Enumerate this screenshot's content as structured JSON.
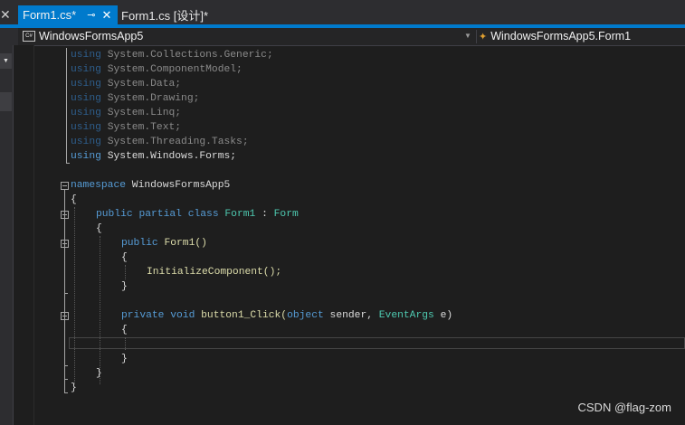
{
  "tabs": {
    "active": {
      "label": "Form1.cs*",
      "pin_icon": "pin-icon",
      "close_icon": "close-icon"
    },
    "inactive": {
      "label": "Form1.cs [设计]*"
    }
  },
  "navbar": {
    "project": "WindowsFormsApp5",
    "class": "WindowsFormsApp5.Form1"
  },
  "code": {
    "usings": [
      "System.Collections.Generic;",
      "System.ComponentModel;",
      "System.Data;",
      "System.Drawing;",
      "System.Linq;",
      "System.Text;",
      "System.Threading.Tasks;",
      "System.Windows.Forms;"
    ],
    "kw_using": "using",
    "kw_namespace": "namespace",
    "namespace_name": " WindowsFormsApp5",
    "open_brace": "{",
    "close_brace": "}",
    "kw_public": "public",
    "kw_partial": "partial",
    "kw_class": "class",
    "class_name": "Form1",
    "colon": " : ",
    "base_class": "Form",
    "ctor_name": " Form1()",
    "init_call": "InitializeComponent();",
    "kw_private": "private",
    "kw_void": "void",
    "handler_name": " button1_Click(",
    "kw_object": "object",
    "param1": " sender, ",
    "eventargs_type": "EventArgs",
    "param2": " e)"
  },
  "watermark": "CSDN @flag-zom"
}
